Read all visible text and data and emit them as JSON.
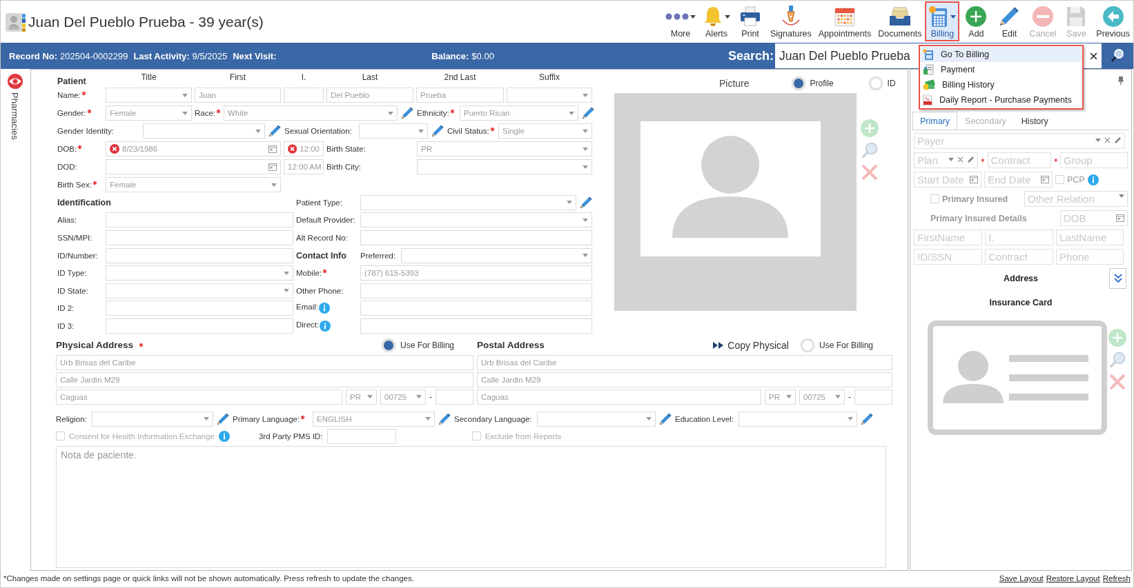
{
  "window": {
    "title": "Juan Del Pueblo Prueba - 39 year(s)"
  },
  "toolbar": [
    {
      "label": "More",
      "kind": "more",
      "dropdown": true,
      "selected": false,
      "disabled": false
    },
    {
      "label": "Alerts",
      "kind": "alerts",
      "dropdown": true,
      "selected": false,
      "disabled": false
    },
    {
      "label": "Print",
      "kind": "print",
      "dropdown": false,
      "selected": false,
      "disabled": false
    },
    {
      "label": "Signatures",
      "kind": "signatures",
      "dropdown": false,
      "selected": false,
      "disabled": false
    },
    {
      "label": "Appointments",
      "kind": "appointments",
      "dropdown": false,
      "selected": false,
      "disabled": false
    },
    {
      "label": "Documents",
      "kind": "documents",
      "dropdown": false,
      "selected": false,
      "disabled": false
    },
    {
      "label": "Billing",
      "kind": "billing",
      "dropdown": true,
      "selected": true,
      "disabled": false
    },
    {
      "label": "Add",
      "kind": "add",
      "dropdown": false,
      "selected": false,
      "disabled": false
    },
    {
      "label": "Edit",
      "kind": "edit",
      "dropdown": false,
      "selected": false,
      "disabled": false
    },
    {
      "label": "Cancel",
      "kind": "cancel",
      "dropdown": false,
      "selected": false,
      "disabled": true
    },
    {
      "label": "Save",
      "kind": "save",
      "dropdown": false,
      "selected": false,
      "disabled": true
    },
    {
      "label": "Previous",
      "kind": "previous",
      "dropdown": false,
      "selected": false,
      "disabled": false
    }
  ],
  "info_bar": [
    {
      "label": "Record No:",
      "value": "202504-0002299"
    },
    {
      "label": "Last Activity:",
      "value": "9/5/2025"
    },
    {
      "label": "Next Visit:"
    },
    {
      "label": "Balance:",
      "value": "$0.00"
    }
  ],
  "search": {
    "label": "Search:",
    "value": "Juan Del Pueblo Prueba"
  },
  "billing_menu": [
    {
      "label": "Go To Billing",
      "kind": "billing",
      "selected": true
    },
    {
      "label": "Payment",
      "kind": "payment",
      "selected": false
    },
    {
      "label": "Billing History",
      "kind": "history",
      "selected": false
    },
    {
      "label": "Daily Report - Purchase Payments",
      "kind": "pdf",
      "selected": false
    }
  ],
  "side_tabs": [
    {
      "label": "Pharmacies"
    }
  ],
  "patient": {
    "heading": "Patient",
    "columns": [
      "Title",
      "First",
      "I.",
      "Last",
      "2nd Last",
      "Suffix"
    ],
    "name": {
      "label": "Name:",
      "required": true,
      "first": "Juan",
      "last": "Del Pueblo",
      "second_last": "Prueba"
    },
    "gender": {
      "label": "Gender:",
      "required": true,
      "value": "Female"
    },
    "race": {
      "label": "Race:",
      "required": true,
      "value": "White"
    },
    "ethnicity": {
      "label": "Ethnicity:",
      "required": true,
      "value": "Puerto Rican"
    },
    "gender_identity": {
      "label": "Gender Identity:",
      "required": false
    },
    "sexual_orientation": {
      "label": "Sexual Orientation:",
      "required": false
    },
    "civil_status": {
      "label": "Civil Status:",
      "required": true,
      "value": "Single"
    },
    "dob": {
      "label": "DOB:",
      "required": true,
      "value": "8/23/1986",
      "time": "12:00",
      "error": true
    },
    "birth_state": {
      "label": "Birth State:",
      "required": false,
      "value": "PR"
    },
    "dod": {
      "label": "DOD:",
      "required": false,
      "time": "12:00 AM",
      "error": false
    },
    "birth_city": {
      "label": "Birth City:",
      "required": false
    },
    "birth_sex": {
      "label": "Birth Sex:",
      "required": true,
      "value": "Female"
    }
  },
  "identification": {
    "heading": "Identification",
    "fields": [
      {
        "label": "Alias:",
        "kind": "text"
      },
      {
        "label": "SSN/MPI:",
        "kind": "text"
      },
      {
        "label": "ID/Number:",
        "kind": "text"
      },
      {
        "label": "ID Type:",
        "kind": "select"
      },
      {
        "label": "ID State:",
        "kind": "select"
      },
      {
        "label": "ID 2:",
        "kind": "text"
      },
      {
        "label": "ID 3:",
        "kind": "text"
      }
    ]
  },
  "details": [
    {
      "label": "Patient Type:",
      "kind": "select",
      "editable": true
    },
    {
      "label": "Default Provider:",
      "kind": "select",
      "editable": false
    },
    {
      "label": "Alt Record No:",
      "kind": "text",
      "editable": false
    }
  ],
  "contact_info": {
    "heading": "Contact Info",
    "fields": [
      {
        "label": "Preferred:",
        "kind": "select",
        "required": false,
        "info": false
      },
      {
        "label": "Mobile:",
        "kind": "text",
        "required": true,
        "info": false,
        "value": "(787) 615-5393"
      },
      {
        "label": "Other Phone:",
        "kind": "text",
        "required": false,
        "info": false
      },
      {
        "label": "Email:",
        "kind": "text",
        "required": false,
        "info": true
      },
      {
        "label": "Direct:",
        "kind": "text",
        "required": false,
        "info": true
      }
    ]
  },
  "picture": {
    "label": "Picture",
    "options": [
      {
        "label": "Profile",
        "selected": true
      },
      {
        "label": "ID",
        "selected": false
      }
    ]
  },
  "physical_address": {
    "heading": "Physical Address",
    "required": true,
    "use_for_billing": {
      "label": "Use For Billing",
      "checked": true
    },
    "line1": "Urb Brisas del Caribe",
    "line2": "Calle Jardin M29",
    "city": "Caguas",
    "state": "PR",
    "zip": "00725",
    "zip_separator": "-"
  },
  "postal_address": {
    "heading": "Postal Address",
    "required": false,
    "copy_button": "Copy Physical",
    "use_for_billing": {
      "label": "Use For Billing",
      "checked": false
    },
    "line1": "Urb Brisas del Caribe",
    "line2": "Calle Jardin M29",
    "city": "Caguas",
    "state": "PR",
    "zip": "00725",
    "zip_separator": "-"
  },
  "languages": [
    {
      "label": "Religion:",
      "required": false
    },
    {
      "label": "Primary Language:",
      "required": true,
      "value": "ENGLISH"
    },
    {
      "label": "Secondary Language:",
      "required": false
    },
    {
      "label": "Education Level:",
      "required": false
    }
  ],
  "consent": {
    "label": "Consent for Health Information Exchange",
    "checked": false
  },
  "third_party_pms_id": {
    "label": "3rd Party PMS ID:"
  },
  "exclude_from_reports": {
    "label": "Exclude from Reports",
    "checked": false
  },
  "notes": {
    "placeholder": "Nota de paciente."
  },
  "insurance": {
    "tabs": [
      {
        "label": "Primary",
        "selected": true,
        "disabled": false
      },
      {
        "label": "Secondary",
        "selected": false,
        "disabled": true
      },
      {
        "label": "History",
        "selected": false,
        "disabled": false
      }
    ],
    "payer": {
      "placeholder": "Payer"
    },
    "plan": {
      "placeholder": "Plan"
    },
    "contract": {
      "placeholder": "Contract",
      "required": true
    },
    "group": {
      "placeholder": "Group",
      "required": true
    },
    "start_date": {
      "placeholder": "Start Date"
    },
    "end_date": {
      "placeholder": "End Date"
    },
    "pcp": {
      "label": "PCP",
      "checked": false
    },
    "primary_insured": {
      "label": "Primary Insured",
      "checked": false
    },
    "other_relation": {
      "placeholder": "Other Relation"
    },
    "insured_details": {
      "label": "Primary Insured Details",
      "dob": {
        "placeholder": "DOB"
      }
    },
    "insured_fields": [
      {
        "placeholder": "FirstName"
      },
      {
        "placeholder": "I."
      },
      {
        "placeholder": "LastName"
      },
      {
        "placeholder": "ID/SSN"
      },
      {
        "placeholder": "Contract"
      },
      {
        "placeholder": "Phone"
      }
    ],
    "address_label": "Address",
    "card_label": "Insurance Card"
  },
  "footer": {
    "note": "*Changes made on settings page or quick links will not be shown automatically. Press refresh to update the changes.",
    "links": [
      "Save Layout",
      "Restore Layout",
      "Refresh"
    ]
  }
}
